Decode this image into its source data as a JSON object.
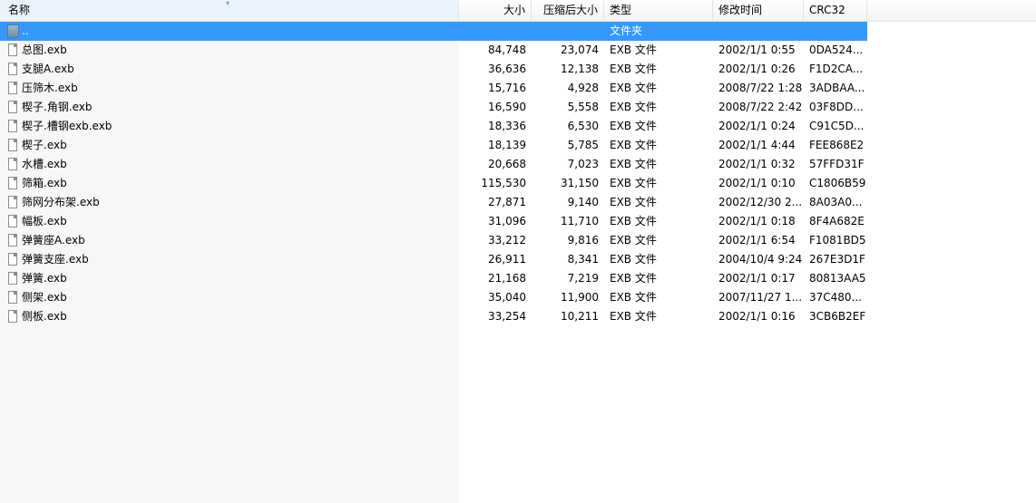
{
  "columns": {
    "name": "名称",
    "size": "大小",
    "packed": "压缩后大小",
    "type": "类型",
    "modified": "修改时间",
    "crc": "CRC32"
  },
  "parent_row": {
    "name": "..",
    "type": "文件夹"
  },
  "files": [
    {
      "name": "总图.exb",
      "size": "84,748",
      "packed": "23,074",
      "type": "EXB 文件",
      "modified": "2002/1/1 0:55",
      "crc": "0DA524..."
    },
    {
      "name": "支腿A.exb",
      "size": "36,636",
      "packed": "12,138",
      "type": "EXB 文件",
      "modified": "2002/1/1 0:26",
      "crc": "F1D2CA..."
    },
    {
      "name": "压筛木.exb",
      "size": "15,716",
      "packed": "4,928",
      "type": "EXB 文件",
      "modified": "2008/7/22 1:28",
      "crc": "3ADBAA..."
    },
    {
      "name": "楔子.角钢.exb",
      "size": "16,590",
      "packed": "5,558",
      "type": "EXB 文件",
      "modified": "2008/7/22 2:42",
      "crc": "03F8DD..."
    },
    {
      "name": "楔子.槽钢exb.exb",
      "size": "18,336",
      "packed": "6,530",
      "type": "EXB 文件",
      "modified": "2002/1/1 0:24",
      "crc": "C91C5D..."
    },
    {
      "name": "楔子.exb",
      "size": "18,139",
      "packed": "5,785",
      "type": "EXB 文件",
      "modified": "2002/1/1 4:44",
      "crc": "FEE868E2"
    },
    {
      "name": "水槽.exb",
      "size": "20,668",
      "packed": "7,023",
      "type": "EXB 文件",
      "modified": "2002/1/1 0:32",
      "crc": "57FFD31F"
    },
    {
      "name": "筛箱.exb",
      "size": "115,530",
      "packed": "31,150",
      "type": "EXB 文件",
      "modified": "2002/1/1 0:10",
      "crc": "C1806B59"
    },
    {
      "name": "筛网分布架.exb",
      "size": "27,871",
      "packed": "9,140",
      "type": "EXB 文件",
      "modified": "2002/12/30 2...",
      "crc": "8A03A0..."
    },
    {
      "name": "幅板.exb",
      "size": "31,096",
      "packed": "11,710",
      "type": "EXB 文件",
      "modified": "2002/1/1 0:18",
      "crc": "8F4A682E"
    },
    {
      "name": "弹簧座A.exb",
      "size": "33,212",
      "packed": "9,816",
      "type": "EXB 文件",
      "modified": "2002/1/1 6:54",
      "crc": "F1081BD5"
    },
    {
      "name": "弹簧支座.exb",
      "size": "26,911",
      "packed": "8,341",
      "type": "EXB 文件",
      "modified": "2004/10/4 9:24",
      "crc": "267E3D1F"
    },
    {
      "name": "弹簧.exb",
      "size": "21,168",
      "packed": "7,219",
      "type": "EXB 文件",
      "modified": "2002/1/1 0:17",
      "crc": "80813AA5"
    },
    {
      "name": "侧架.exb",
      "size": "35,040",
      "packed": "11,900",
      "type": "EXB 文件",
      "modified": "2007/11/27 1...",
      "crc": "37C480..."
    },
    {
      "name": "侧板.exb",
      "size": "33,254",
      "packed": "10,211",
      "type": "EXB 文件",
      "modified": "2002/1/1 0:16",
      "crc": "3CB6B2EF"
    }
  ],
  "colors": {
    "selection": "#3399ff",
    "left_pane": "#f7f7f7"
  },
  "icons": {
    "folder": "folder-up-icon",
    "file": "file-icon"
  }
}
